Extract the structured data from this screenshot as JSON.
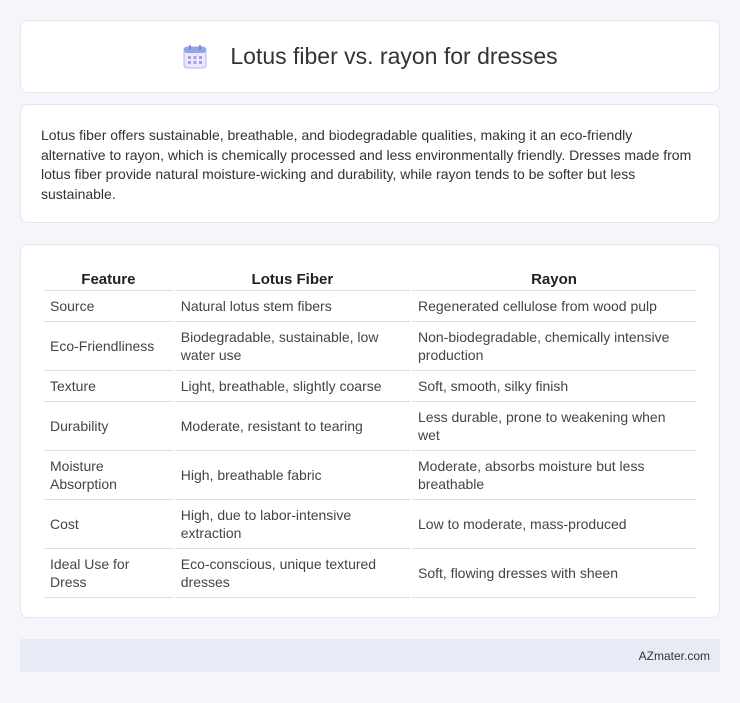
{
  "header": {
    "title": "Lotus fiber vs. rayon for dresses",
    "icon": "calendar-icon"
  },
  "intro": {
    "text": "Lotus fiber offers sustainable, breathable, and biodegradable qualities, making it an eco-friendly alternative to rayon, which is chemically processed and less environmentally friendly. Dresses made from lotus fiber provide natural moisture-wicking and durability, while rayon tends to be softer but less sustainable."
  },
  "table": {
    "headers": [
      "Feature",
      "Lotus Fiber",
      "Rayon"
    ],
    "rows": [
      [
        "Source",
        "Natural lotus stem fibers",
        "Regenerated cellulose from wood pulp"
      ],
      [
        "Eco-Friendliness",
        "Biodegradable, sustainable, low water use",
        "Non-biodegradable, chemically intensive production"
      ],
      [
        "Texture",
        "Light, breathable, slightly coarse",
        "Soft, smooth, silky finish"
      ],
      [
        "Durability",
        "Moderate, resistant to tearing",
        "Less durable, prone to weakening when wet"
      ],
      [
        "Moisture Absorption",
        "High, breathable fabric",
        "Moderate, absorbs moisture but less breathable"
      ],
      [
        "Cost",
        "High, due to labor-intensive extraction",
        "Low to moderate, mass-produced"
      ],
      [
        "Ideal Use for Dress",
        "Eco-conscious, unique textured dresses",
        "Soft, flowing dresses with sheen"
      ]
    ]
  },
  "footer": {
    "brand": "AZmater.com"
  },
  "colors": {
    "background": "#f4f6fb",
    "card": "#ffffff",
    "footer": "#e6ebf6",
    "icon_accent": "#8a7fd8"
  }
}
